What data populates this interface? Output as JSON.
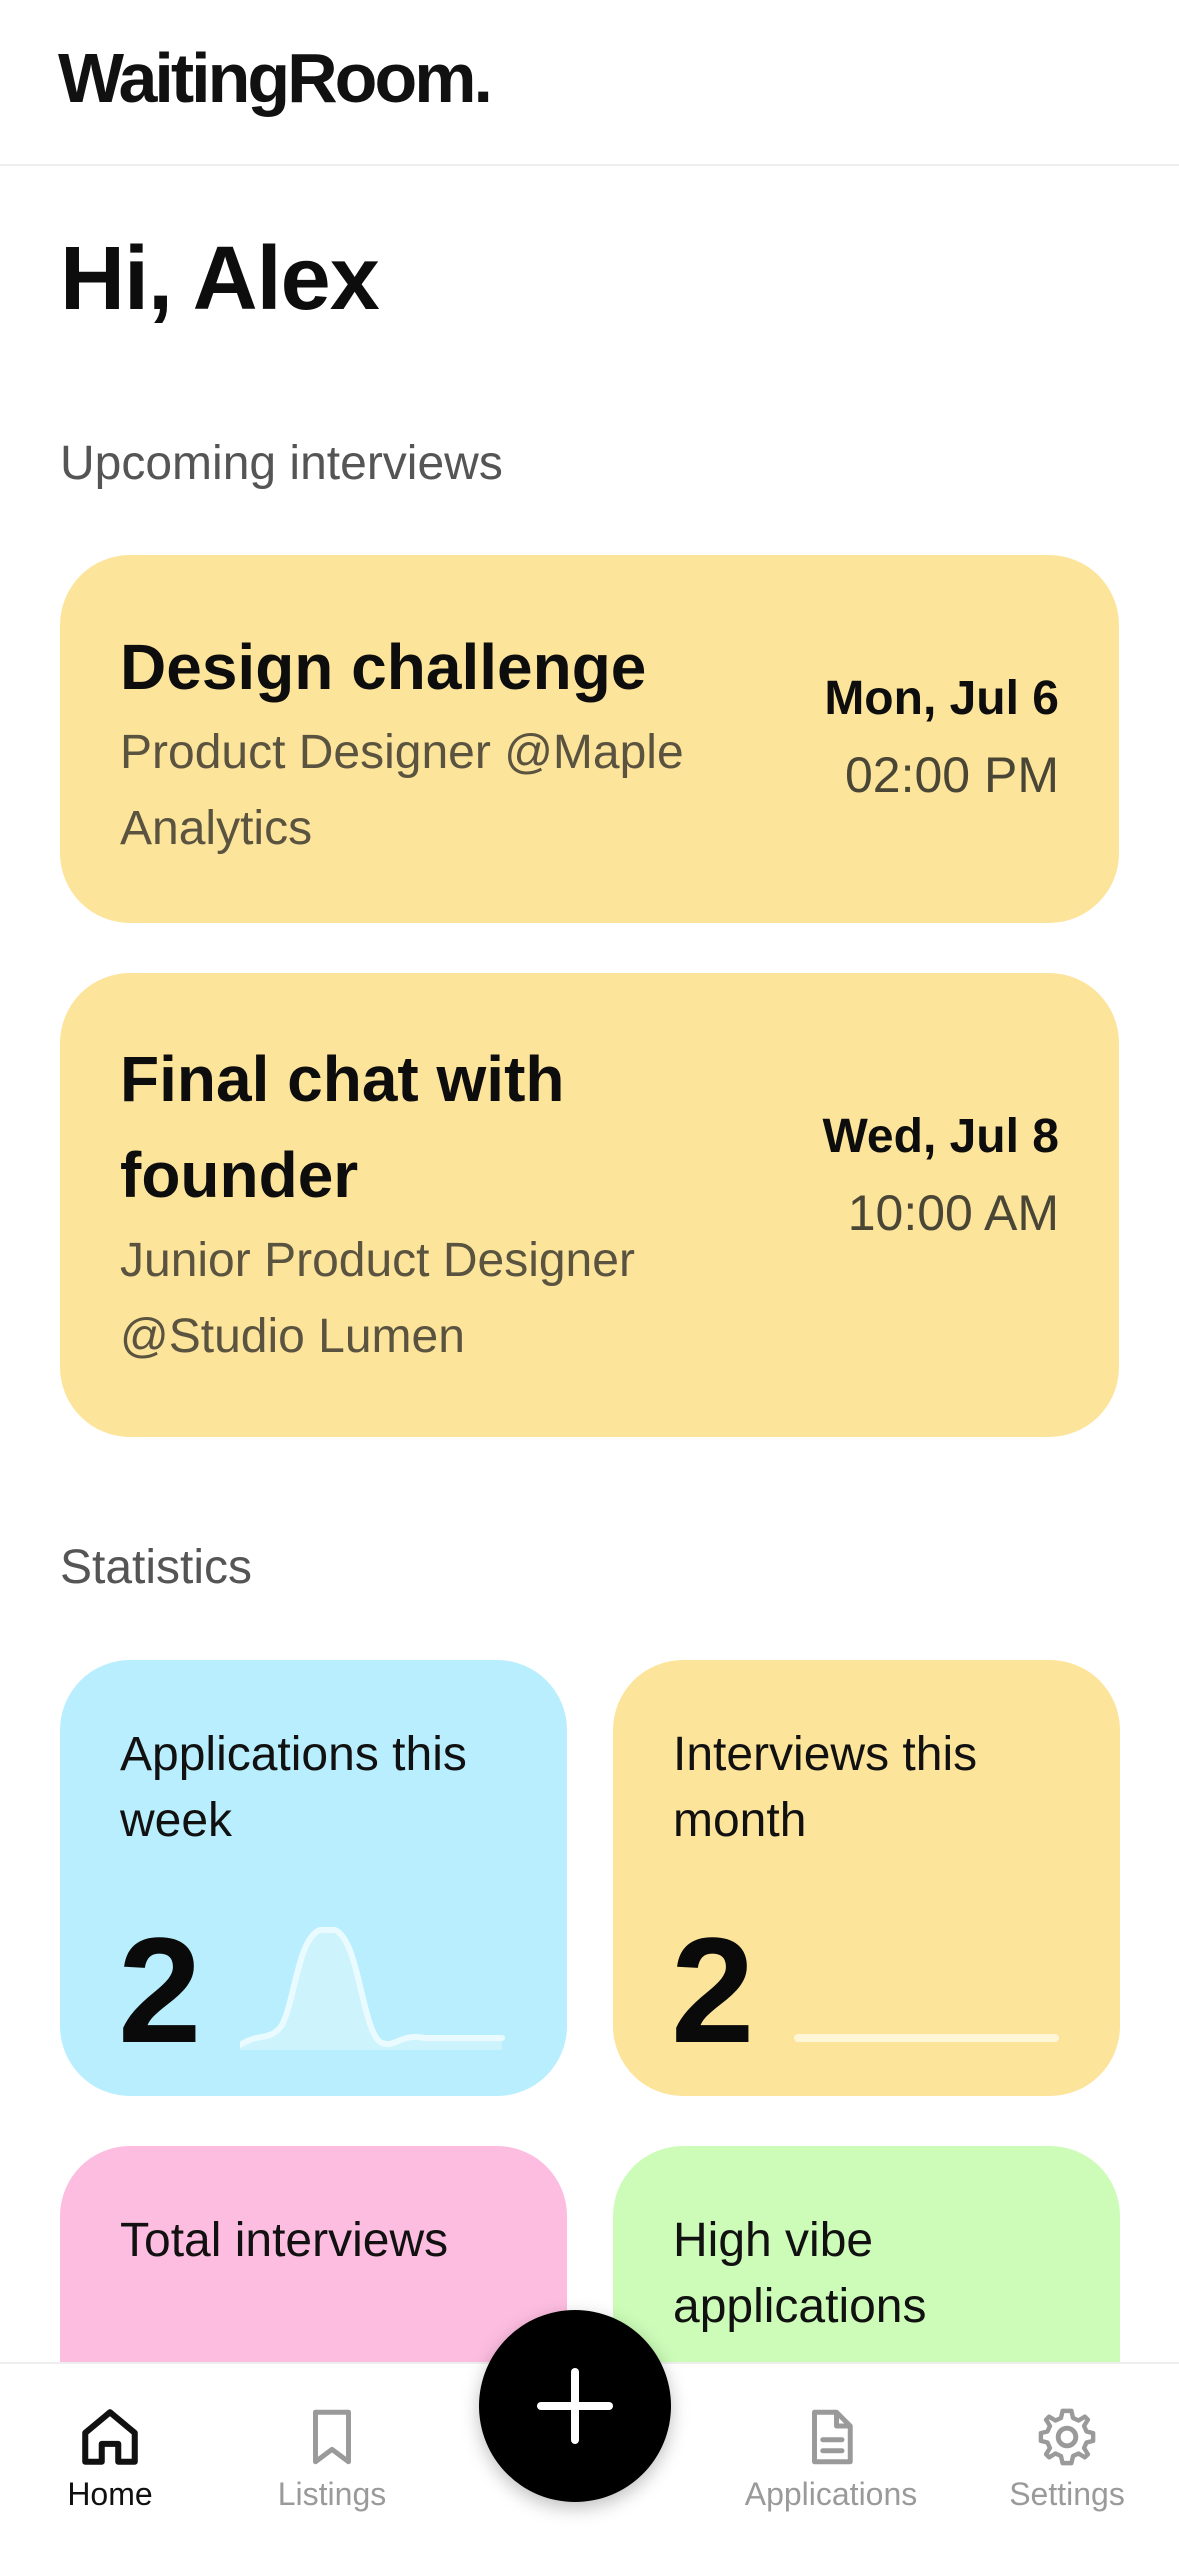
{
  "app": {
    "logo": "WaitingRoom."
  },
  "greeting": "Hi, Alex",
  "sections": {
    "upcoming": "Upcoming interviews",
    "statistics": "Statistics"
  },
  "interviews": [
    {
      "title": "Design challenge",
      "subtitle": "Product Designer @Maple Analytics",
      "date": "Mon, Jul 6",
      "time": "02:00 PM"
    },
    {
      "title": "Final chat with founder",
      "subtitle": "Junior Product Designer @Studio Lumen",
      "date": "Wed, Jul 8",
      "time": "10:00 AM"
    }
  ],
  "stats": [
    {
      "label": "Applications this week",
      "value": "2",
      "color": "#b8eefd",
      "spark": "peak"
    },
    {
      "label": "Interviews this month",
      "value": "2",
      "color": "#fde49b",
      "spark": "flat"
    },
    {
      "label": "Total interviews",
      "value": "",
      "color": "#fdbde0"
    },
    {
      "label": "High vibe applications",
      "value": "",
      "color": "#ccfcb8"
    }
  ],
  "nav": [
    {
      "label": "Home",
      "icon": "home-icon",
      "active": true
    },
    {
      "label": "Listings",
      "icon": "bookmark-icon",
      "active": false
    },
    {
      "label": "Applications",
      "icon": "document-icon",
      "active": false
    },
    {
      "label": "Settings",
      "icon": "gear-icon",
      "active": false
    }
  ],
  "fab": {
    "icon": "plus-icon"
  },
  "colors": {
    "interview_card": "#fde49b",
    "nav_active": "#111111",
    "nav_inactive": "#9a9a9a"
  }
}
